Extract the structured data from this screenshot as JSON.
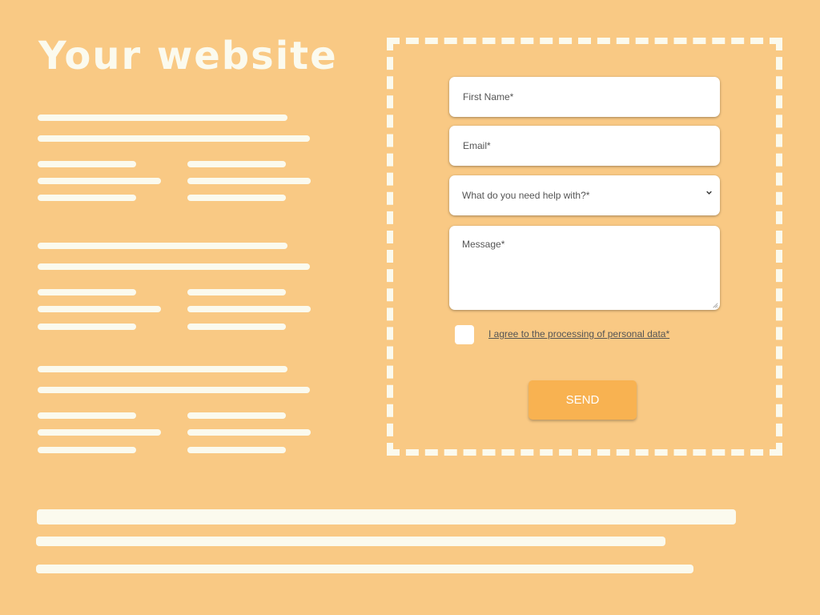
{
  "hero": {
    "title": "Your website"
  },
  "form": {
    "first_name_placeholder": "First Name*",
    "email_placeholder": "Email*",
    "help_select_value": "What do you need help with?*",
    "message_placeholder": "Message*",
    "consent_label": "I agree to the processing of personal data*",
    "consent_checked": false,
    "send_label": "SEND"
  },
  "colors": {
    "background": "#f9c984",
    "placeholder_bar": "#fbfaee",
    "button": "#f8b251"
  }
}
